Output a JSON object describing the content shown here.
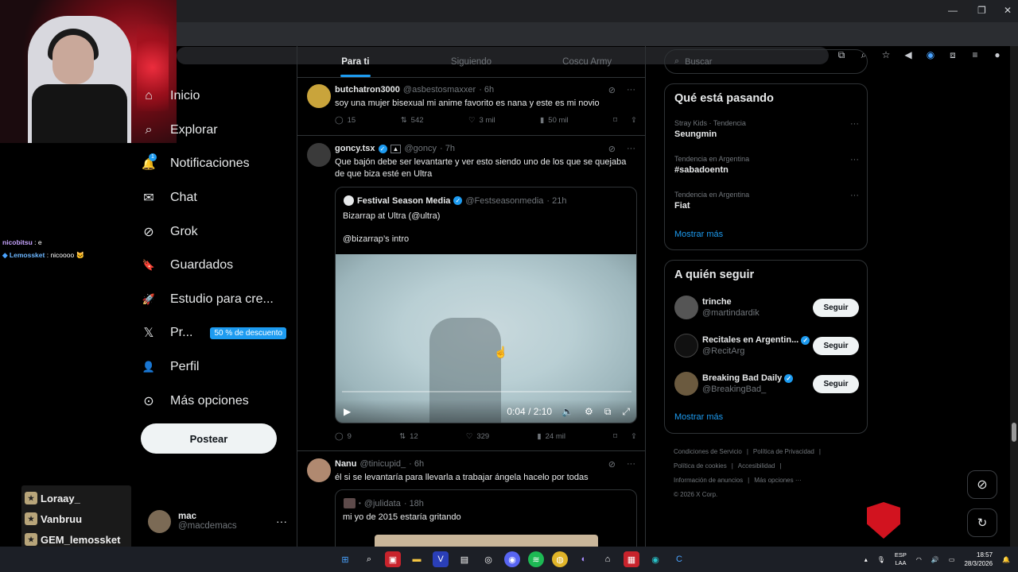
{
  "browser": {
    "window_controls": [
      "—",
      "❐",
      "✕"
    ],
    "toolbar_icons": [
      "cast-icon",
      "zoom-icon",
      "star-icon",
      "speaker-icon",
      "extension-a-icon",
      "extensions-icon",
      "tab-search-icon",
      "profile-icon",
      "menu-icon"
    ]
  },
  "stream_overlay": {
    "chat": [
      {
        "user": "nicobitsu",
        "sep": " : ",
        "message": "e"
      },
      {
        "user": "Lemossket",
        "sep": " : ",
        "message": "nicoooo 🐱"
      }
    ],
    "viewers": [
      "Loraay_",
      "Vanbruu",
      "GEM_lemossket"
    ]
  },
  "nav": {
    "items": [
      {
        "icon": "home-icon",
        "glyph": "⌂",
        "label": "Inicio"
      },
      {
        "icon": "explore-icon",
        "glyph": "⌕",
        "label": "Explorar"
      },
      {
        "icon": "bell-icon",
        "glyph": "🔔",
        "label": "Notificaciones"
      },
      {
        "icon": "mail-icon",
        "glyph": "✉",
        "label": "Chat"
      },
      {
        "icon": "grok-icon",
        "glyph": "⊘",
        "label": "Grok"
      },
      {
        "icon": "bookmark-icon",
        "glyph": "🔖",
        "label": "Guardados"
      },
      {
        "icon": "rocket-icon",
        "glyph": "🚀",
        "label": "Estudio para cre..."
      },
      {
        "icon": "x-logo-icon",
        "glyph": "𝕏",
        "label": "Pr..."
      },
      {
        "icon": "person-icon",
        "glyph": "👤",
        "label": "Perfil"
      },
      {
        "icon": "more-circle-icon",
        "glyph": "⊙",
        "label": "Más opciones"
      }
    ],
    "notification_count": "1",
    "promo_badge": "50 % de descuento",
    "post_button": "Postear",
    "account": {
      "name": "mac",
      "handle": "@macdemacs",
      "more": "···"
    }
  },
  "feed": {
    "tabs": [
      "Para ti",
      "Siguiendo",
      "Coscu Army"
    ],
    "posts": [
      {
        "name": "butchatron3000",
        "handle": "@asbestosmaxxer",
        "time": "· 6h",
        "text": "soy una mujer bisexual mi anime favorito es nana y este es mi novio",
        "replies": "15",
        "reposts": "542",
        "likes": "3 mil",
        "views": "50 mil"
      },
      {
        "name": "goncy.tsx",
        "handle": "@goncy",
        "time": "· 7h",
        "text": "Que bajón debe ser levantarte y ver esto siendo uno de los que se quejaba de que biza esté en Ultra",
        "quote": {
          "name": "Festival Season Media",
          "handle": "@Festseasonmedia",
          "time": "· 21h",
          "line1": "Bizarrap at Ultra (@ultra)",
          "line2": "@bizarrap’s intro",
          "video_time": "0:04 / 2:10"
        },
        "replies": "9",
        "reposts": "12",
        "likes": "329",
        "views": "24 mil"
      },
      {
        "name": "Nanu",
        "handle": "@tinicupid_",
        "time": "· 6h",
        "text": "él si se levantaría para llevarla a trabajar ángela hacelo por todas",
        "quote": {
          "handle": "@julidata",
          "time": "· 18h",
          "line1": "mi yo de 2015 estaría gritando"
        }
      }
    ]
  },
  "sidebar": {
    "search_placeholder": "Buscar",
    "trends_title": "Qué está pasando",
    "trends": [
      {
        "meta": "Stray Kids · Tendencia",
        "topic": "Seungmin"
      },
      {
        "meta": "Tendencia en Argentina",
        "topic": "#sabadoentn"
      },
      {
        "meta": "Tendencia en Argentina",
        "topic": "Fiat"
      }
    ],
    "trends_more": "Mostrar más",
    "follow_title": "A quién seguir",
    "follow": [
      {
        "name": "trinche",
        "handle": "@martindardik",
        "verified": false
      },
      {
        "name": "Recitales en Argentin...",
        "handle": "@RecitArg",
        "verified": true
      },
      {
        "name": "Breaking Bad Daily",
        "handle": "@BreakingBad_",
        "verified": true
      }
    ],
    "follow_button": "Seguir",
    "follow_more": "Mostrar más",
    "footer": [
      "Condiciones de Servicio",
      "|",
      "Política de Privacidad",
      "|",
      "Política de cookies",
      "|",
      "Accesibilidad",
      "|",
      "Información de anuncios",
      "|",
      "Más opciones ···",
      "© 2026 X Corp."
    ]
  },
  "taskbar": {
    "lang1": "ESP",
    "lang2": "LAA",
    "time": "18:57",
    "date": "28/3/2026"
  },
  "colors": {
    "accent": "#1d9bf0",
    "background": "#000000",
    "border": "#2f3336",
    "muted": "#71767b",
    "msi_red": "#d2131f"
  }
}
